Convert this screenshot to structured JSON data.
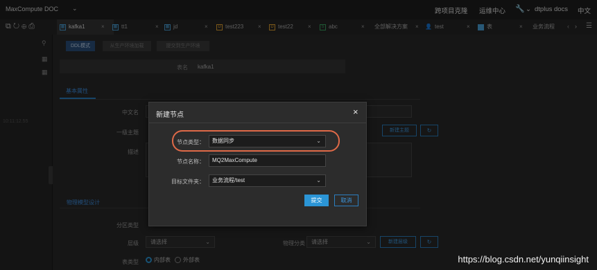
{
  "topbar": {
    "project": "MaxCompute DOC",
    "links": [
      "跨项目克隆",
      "运维中心",
      "dtplus docs",
      "中文"
    ]
  },
  "tabs": [
    {
      "label": "kafka1",
      "icon": "table-icon",
      "active": true
    },
    {
      "label": "tt1",
      "icon": "table-icon"
    },
    {
      "label": "jd",
      "icon": "table-icon"
    },
    {
      "label": "test223",
      "icon": "dataflow-icon"
    },
    {
      "label": "test22",
      "icon": "dataflow-icon"
    },
    {
      "label": "abc",
      "icon": "sync-icon"
    },
    {
      "label": "全部解决方案",
      "icon": ""
    },
    {
      "label": "test",
      "icon": "user-icon"
    },
    {
      "label": "表",
      "icon": "table-solid-icon"
    },
    {
      "label": "业务流程",
      "icon": ""
    }
  ],
  "main": {
    "mode_buttons": [
      "DDL模式",
      "从生产环境加载",
      "提交到生产环境"
    ],
    "table_name_label": "表名",
    "table_name_value": "kafka1",
    "section_basic": "基本属性",
    "chinese_name_label": "中文名",
    "topic_label": "一级主题",
    "desc_label": "描述",
    "new_topic_button": "新建主题",
    "section_physical": "物理模型设计",
    "partition_label": "分区类型",
    "level_label": "层级",
    "level_placeholder": "请选择",
    "phys_cat_label": "物理分类",
    "phys_cat_placeholder": "请选择",
    "new_level_button": "新建层级",
    "table_type_label": "表类型",
    "inner_table": "内部表",
    "outer_table": "外部表",
    "left_timestamp": "10:11:12.55"
  },
  "modal": {
    "title": "新建节点",
    "node_type_label": "节点类型：",
    "node_type_value": "数据同步",
    "node_name_label": "节点名称：",
    "node_name_value": "MQ2MaxCompute",
    "folder_label": "目标文件夹：",
    "folder_value": "业务流程/test",
    "submit": "提交",
    "cancel": "取消"
  },
  "watermark": "https://blog.csdn.net/yunqiinsight",
  "colors": {
    "accent": "#2b95d6",
    "highlight": "#e06a48"
  }
}
